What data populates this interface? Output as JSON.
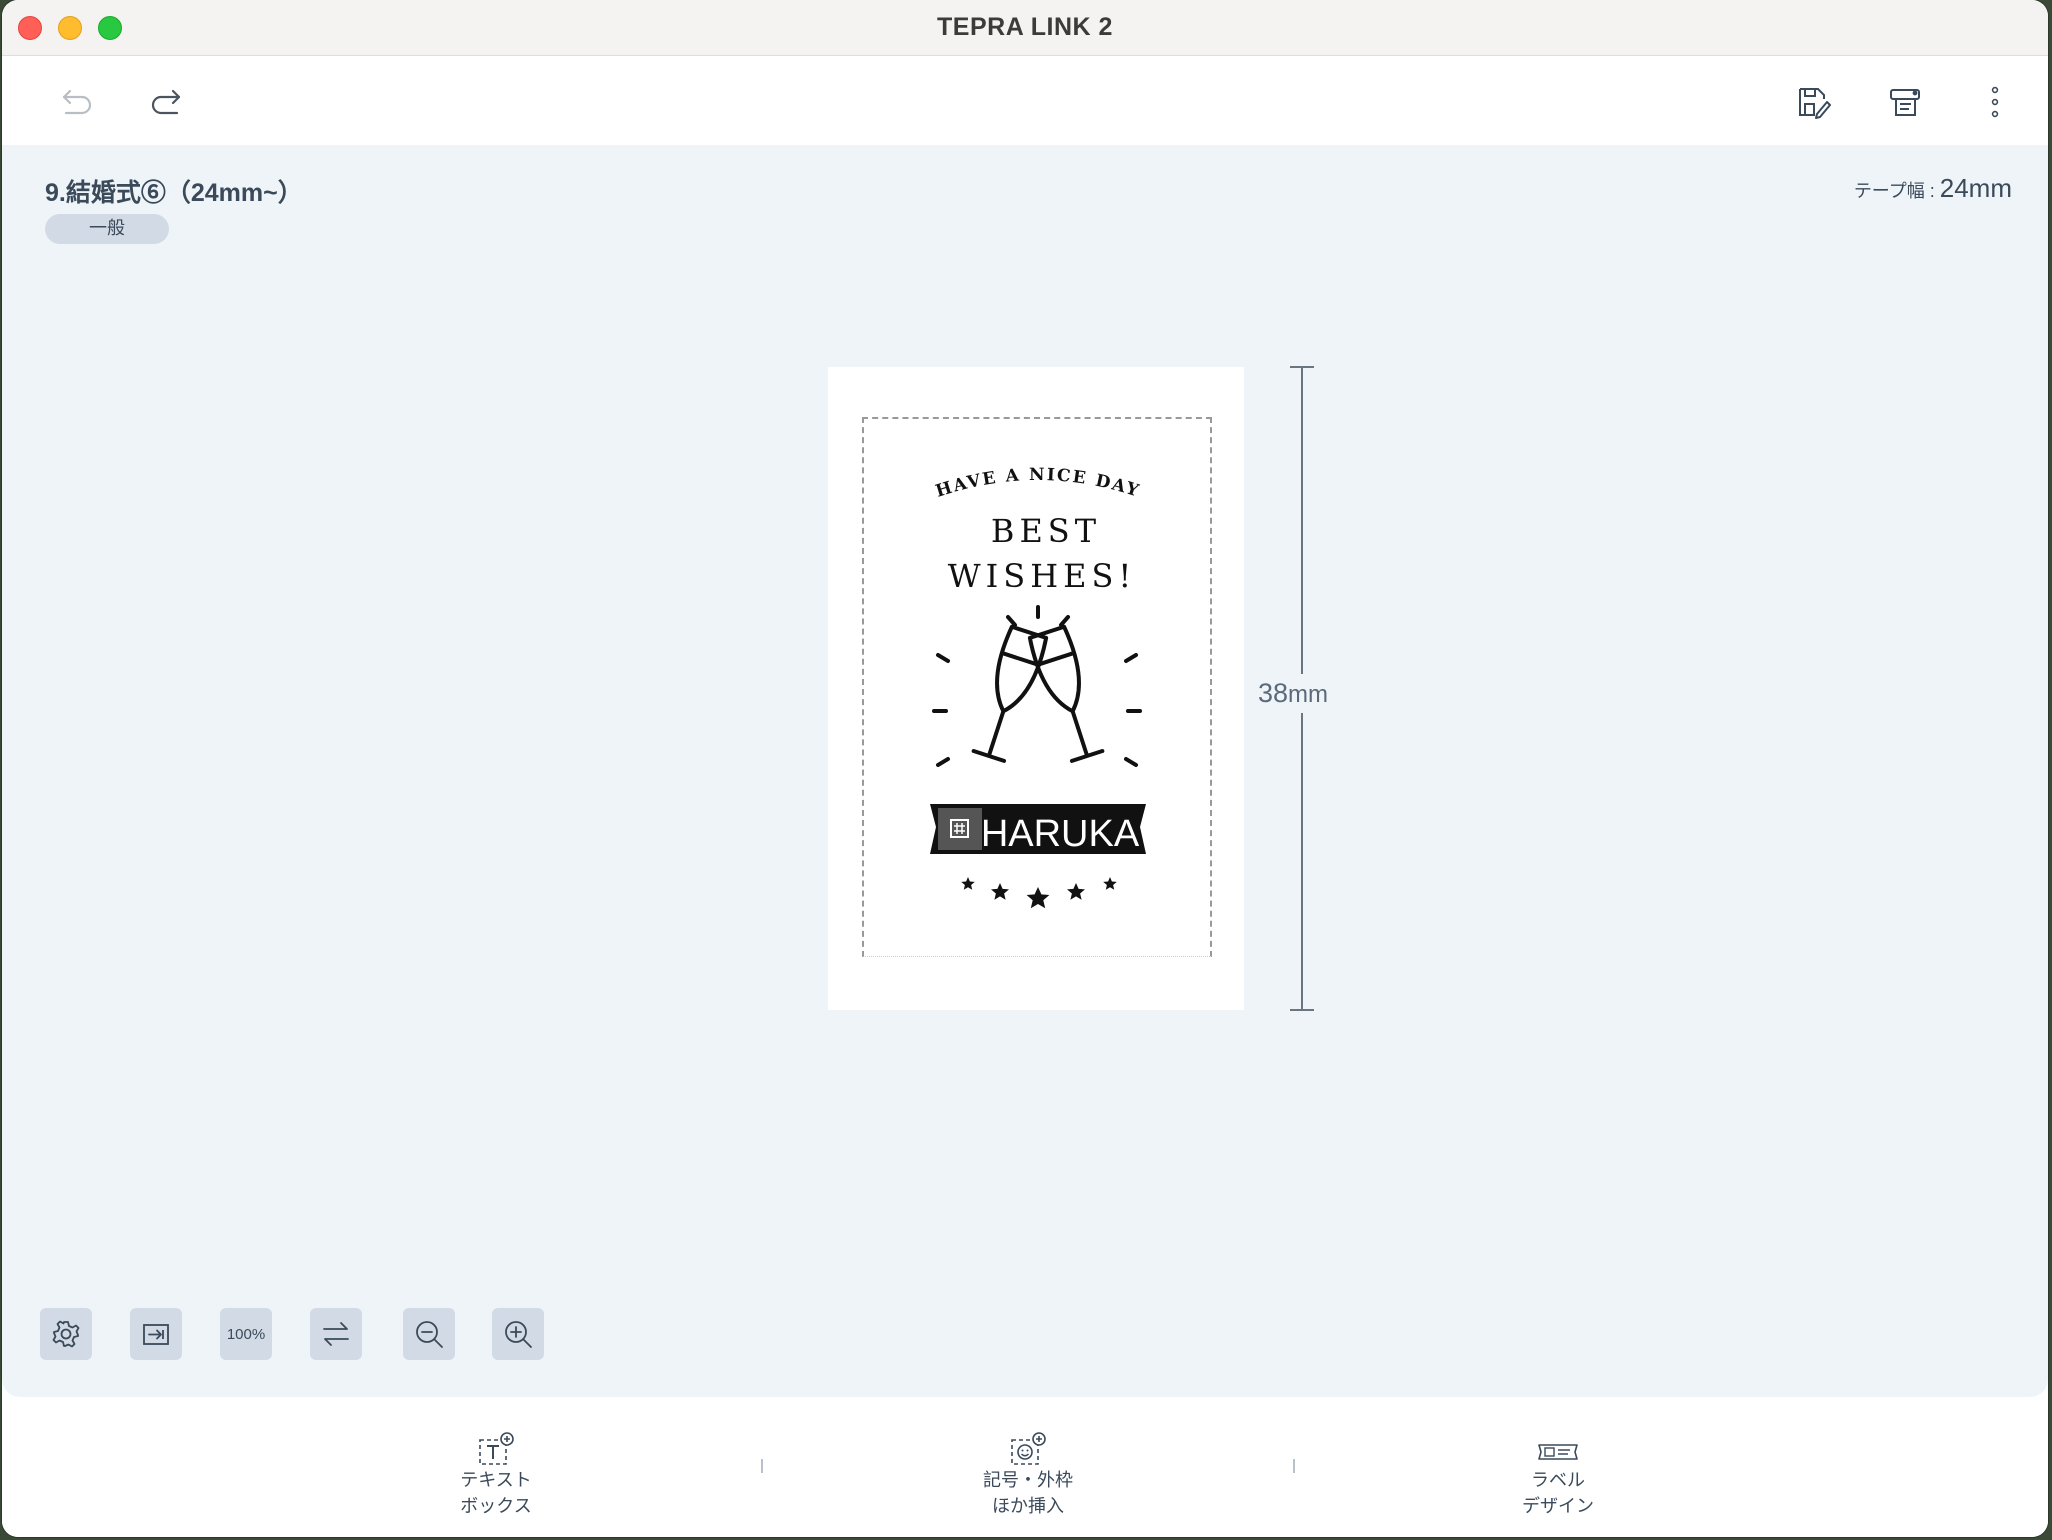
{
  "window": {
    "title": "TEPRA LINK 2"
  },
  "toolbar": {
    "undo": "undo-icon",
    "redo": "redo-icon",
    "save": "save-icon",
    "print": "print-icon",
    "more": "more-vertical-icon"
  },
  "document": {
    "title": "9.結婚式⑥（24mm~）",
    "category": "一般",
    "tape_width_label": "テープ幅 : ",
    "tape_width_value": "24mm"
  },
  "label": {
    "line1": "HAVE A NICE DAY",
    "line2": "BEST",
    "line3": "WISHES!",
    "name_field": "HARUKA",
    "length_value": "38",
    "length_unit": "mm"
  },
  "tools": {
    "settings": "gear-icon",
    "fit": "fit-screen-icon",
    "zoom_100": "100%",
    "rotate": "swap-arrows-icon",
    "zoom_out": "zoom-out-icon",
    "zoom_in": "zoom-in-icon"
  },
  "bottom_bar": {
    "text_box": {
      "line1": "テキスト",
      "line2": "ボックス"
    },
    "insert_symbol": {
      "line1": "記号・外枠",
      "line2": "ほか挿入"
    },
    "label_design": {
      "line1": "ラベル",
      "line2": "デザイン"
    }
  },
  "colors": {
    "canvas_bg": "#eff4f8",
    "tool_bg": "#d2dbe5",
    "text": "#3a4a5a"
  }
}
